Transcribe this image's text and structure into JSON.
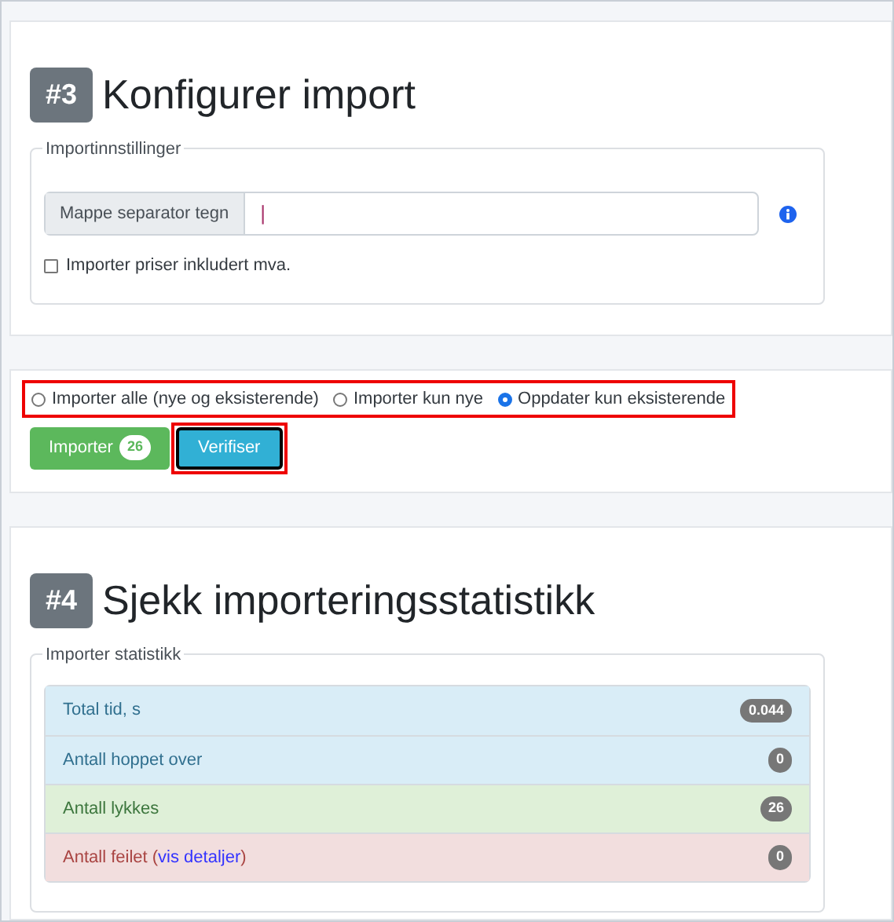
{
  "step3": {
    "number": "#3",
    "title": "Konfigurer import",
    "fieldset": {
      "legend": "Importinnstillinger",
      "separator": {
        "label": "Mappe separator tegn",
        "value": "|"
      },
      "checkbox": {
        "label": "Importer priser inkludert mva.",
        "checked": false
      }
    }
  },
  "mode": {
    "options": [
      {
        "label": "Importer alle (nye og eksisterende)",
        "selected": false
      },
      {
        "label": "Importer kun nye",
        "selected": false
      },
      {
        "label": "Oppdater kun eksisterende",
        "selected": true
      }
    ],
    "buttons": [
      {
        "kind": "success",
        "label": "Importer",
        "badge": "26",
        "focused": false
      },
      {
        "kind": "info",
        "label": "Verifiser",
        "focused": true
      }
    ]
  },
  "step4": {
    "number": "#4",
    "title": "Sjekk importeringsstatistikk",
    "fieldset": {
      "legend": "Importer statistikk",
      "rows": [
        {
          "kind": "info",
          "label": "Total tid, s",
          "value": "0.044"
        },
        {
          "kind": "info",
          "label": "Antall hoppet over",
          "value": "0"
        },
        {
          "kind": "success",
          "label": "Antall lykkes",
          "value": "26"
        },
        {
          "kind": "danger",
          "label": "Antall feilet (",
          "link": "vis detaljer",
          "label_end": ")",
          "value": "0"
        }
      ]
    }
  }
}
